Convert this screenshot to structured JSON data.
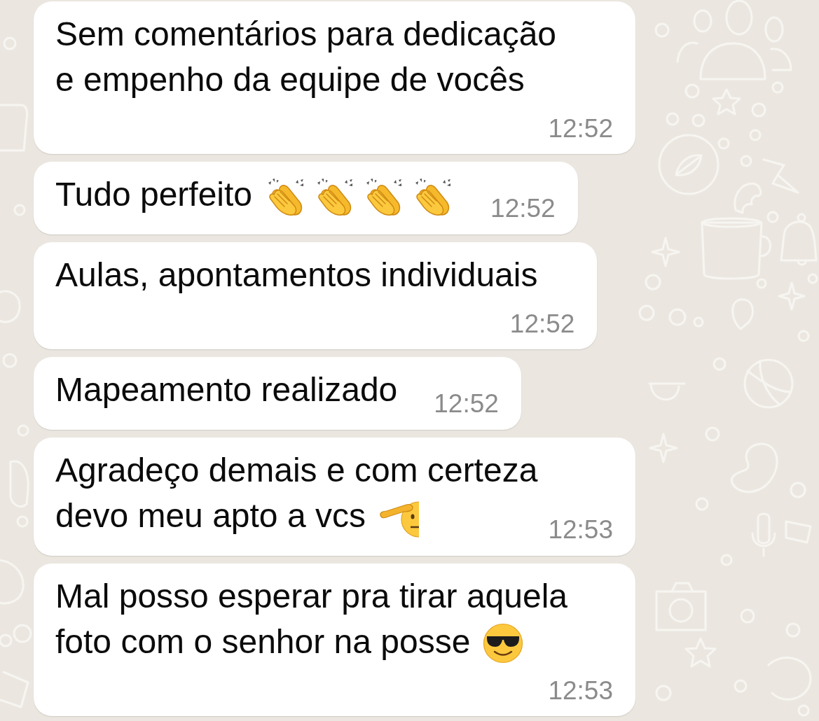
{
  "messages": [
    {
      "text": "Sem comentários para dedicação e empenho da equipe de vocês",
      "time": "12:52"
    },
    {
      "text": "Tudo perfeito",
      "emoji": [
        {
          "kind": "clapping-hands"
        },
        {
          "kind": "clapping-hands"
        },
        {
          "kind": "clapping-hands"
        },
        {
          "kind": "clapping-hands"
        }
      ],
      "time": "12:52"
    },
    {
      "text": "Aulas, apontamentos individuais",
      "time": "12:52"
    },
    {
      "text": "Mapeamento realizado",
      "time": "12:52"
    },
    {
      "text": "Agradeço demais e com certeza devo meu apto a vcs",
      "emoji": [
        {
          "kind": "saluting-face"
        }
      ],
      "time": "12:53"
    },
    {
      "text": "Mal posso esperar pra tirar aquela foto com o senhor na posse",
      "emoji": [
        {
          "kind": "sunglasses-face"
        }
      ],
      "time": "12:53"
    }
  ]
}
